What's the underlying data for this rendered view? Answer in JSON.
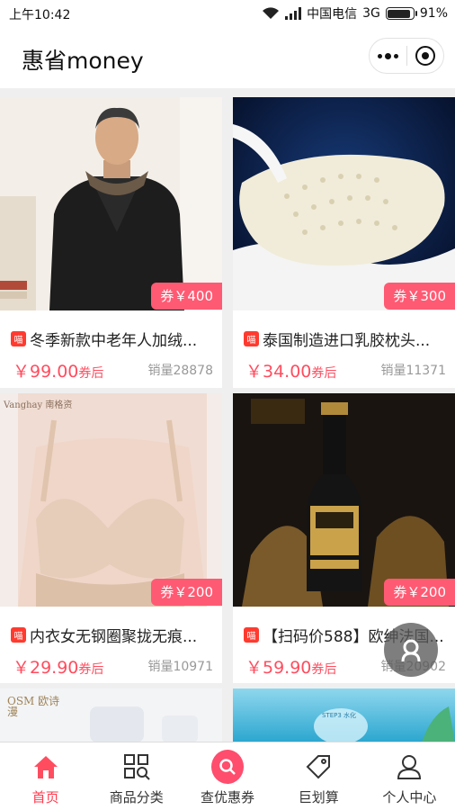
{
  "status": {
    "time": "上午10:42",
    "carrier": "中国电信",
    "network": "3G",
    "battery": "91%",
    "battery_level": 0.91
  },
  "nav": {
    "title": "惠省money"
  },
  "products": [
    {
      "title": "冬季新款中老年人加绒...",
      "coupon": "券￥400",
      "price": "￥99.00",
      "price_suffix": "券后",
      "sales": "销量28878",
      "shop_badge": "喵"
    },
    {
      "title": "泰国制造进口乳胶枕头...",
      "coupon": "券￥300",
      "price": "￥34.00",
      "price_suffix": "券后",
      "sales": "销量11371",
      "shop_badge": "喵"
    },
    {
      "title": "内衣女无钢圈聚拢无痕...",
      "coupon": "券￥200",
      "price": "￥29.90",
      "price_suffix": "券后",
      "sales": "销量10971",
      "shop_badge": "喵",
      "image_text": "Vanghay 南格资"
    },
    {
      "title": "【扫码价588】欧绅法国...",
      "coupon": "券￥200",
      "price": "￥59.90",
      "price_suffix": "券后",
      "sales": "销量20902",
      "shop_badge": "喵"
    },
    {
      "image_text": "OSM 欧诗漫"
    },
    {
      "image_text": "STEP3 水化"
    }
  ],
  "tabs": [
    {
      "label": "首页",
      "icon": "home-icon",
      "active": true
    },
    {
      "label": "商品分类",
      "icon": "category-icon",
      "active": false
    },
    {
      "label": "查优惠券",
      "icon": "search-icon",
      "active": false
    },
    {
      "label": "巨划算",
      "icon": "tag-icon",
      "active": false
    },
    {
      "label": "个人中心",
      "icon": "user-icon",
      "active": false
    }
  ],
  "colors": {
    "accent": "#ff4d5f",
    "coupon_bg": "#ff5a73",
    "tmall_badge": "#ff3b30"
  }
}
